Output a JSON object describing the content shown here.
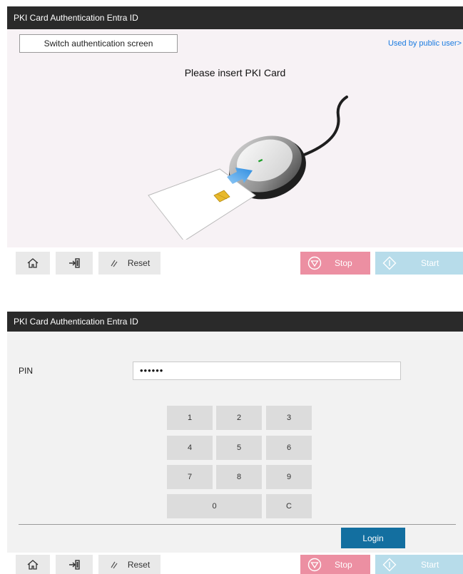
{
  "screen1": {
    "title": "PKI Card Authentication Entra ID",
    "switch_button": "Switch authentication screen",
    "public_user_link": "Used by public user>",
    "message": "Please insert PKI Card",
    "bottom": {
      "reset_label": "Reset",
      "stop_label": "Stop",
      "start_label": "Start"
    }
  },
  "screen2": {
    "title": "PKI Card Authentication Entra ID",
    "pin_label": "PIN",
    "pin_value": "••••••",
    "keypad": [
      "1",
      "2",
      "3",
      "4",
      "5",
      "6",
      "7",
      "8",
      "9",
      "0",
      "C"
    ],
    "login_label": "Login",
    "bottom": {
      "reset_label": "Reset",
      "stop_label": "Stop",
      "start_label": "Start"
    }
  },
  "colors": {
    "titlebar": "#2a2a2a",
    "stop": "#ec8fa2",
    "start": "#b7dcea",
    "login": "#136fa0",
    "link": "#1a7be0"
  },
  "icons": [
    "home-icon",
    "logout-icon",
    "reset-icon",
    "stop-icon",
    "start-icon"
  ]
}
